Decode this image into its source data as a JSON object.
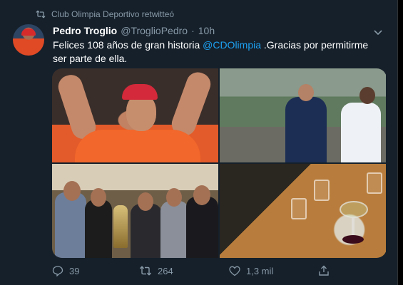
{
  "retweet_banner": {
    "text": "Club Olimpia Deportivo retwitteó",
    "icon": "retweet-icon"
  },
  "tweet": {
    "author_name": "Pedro Troglio",
    "handle": "@TroglioPedro",
    "separator": "·",
    "time": "10h",
    "text_before": "Felices 108 años de gran historia ",
    "mention": "@CDOlimpia",
    "text_after": " .Gracias por permitirme ser parte de ella.",
    "media_count": 4
  },
  "actions": {
    "replies": "39",
    "retweets": "264",
    "likes": "1,3 mil"
  },
  "colors": {
    "background": "#15202b",
    "text": "#ffffff",
    "muted": "#8899a6",
    "accent": "#1da1f2"
  }
}
